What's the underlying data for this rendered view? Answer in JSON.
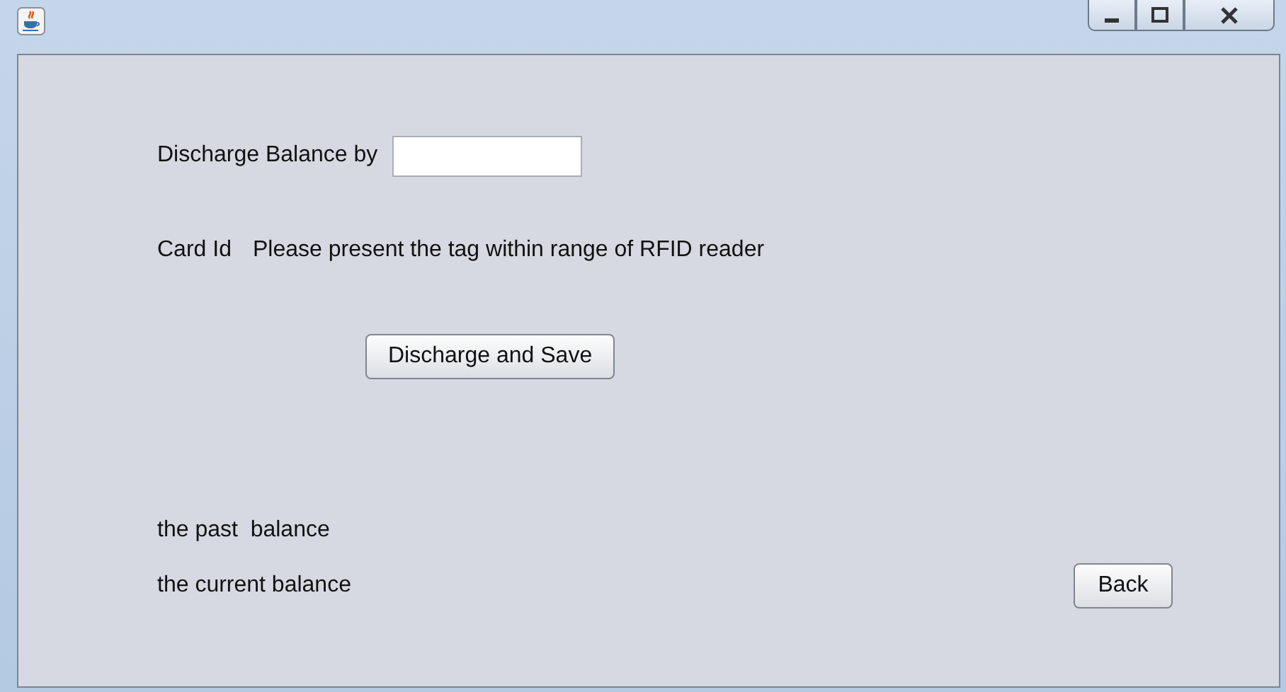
{
  "window": {
    "controls": [
      {
        "kind": "minimize"
      },
      {
        "kind": "maximize"
      },
      {
        "kind": "close"
      }
    ]
  },
  "discharge": {
    "label": "Discharge Balance by"
  },
  "card": {
    "label": "Card Id",
    "message": "Please present the tag within range of RFID reader"
  },
  "save_button": "Discharge and Save",
  "past_balance": "the past  balance",
  "current_balance": "the current balance",
  "back_button": "Back"
}
